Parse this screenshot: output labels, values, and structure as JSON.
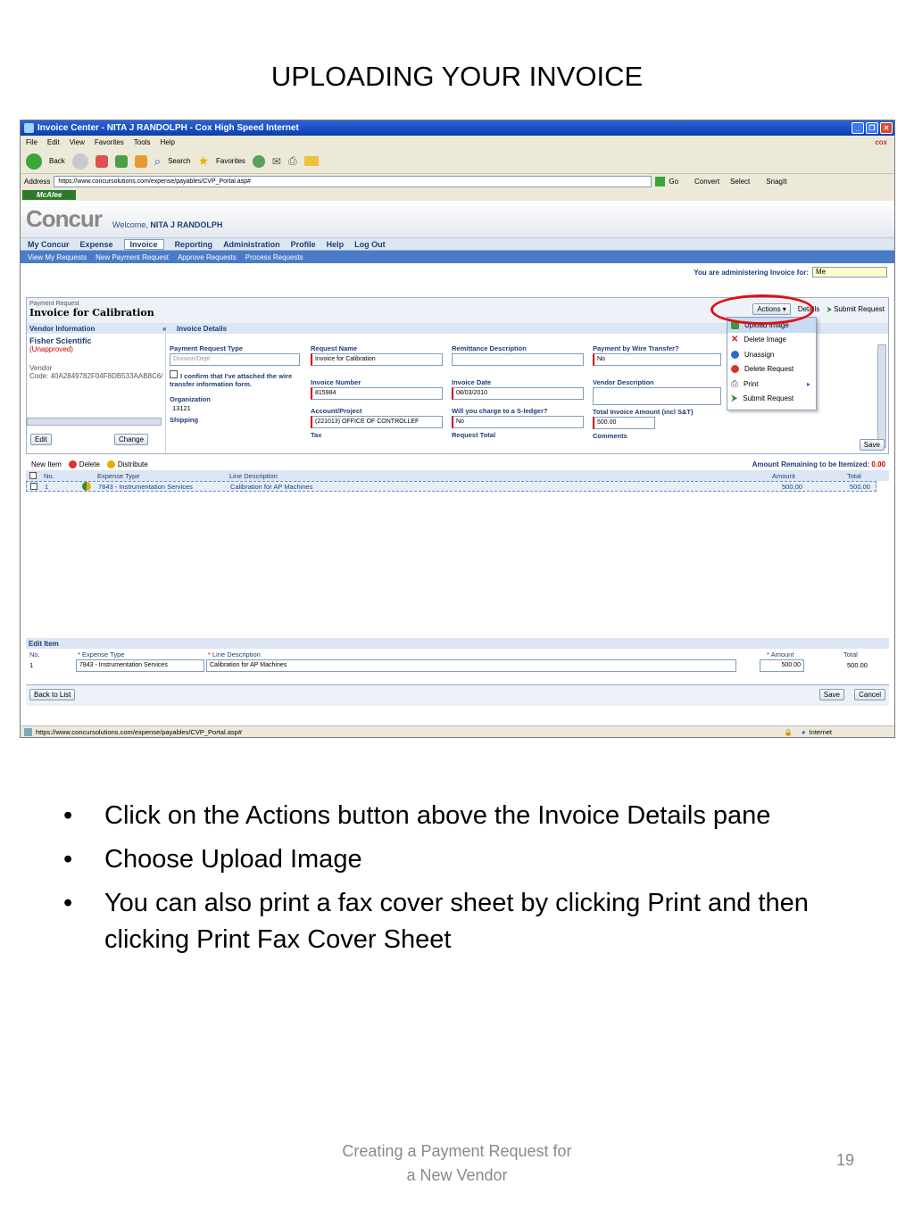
{
  "slide": {
    "title": "UPLOADING YOUR INVOICE",
    "bullets": [
      "Click on the Actions button above the Invoice Details pane",
      "Choose Upload Image",
      "You can also print a fax cover sheet by clicking Print and then clicking Print Fax Cover Sheet"
    ],
    "footer_line1": "Creating a Payment Request for",
    "footer_line2": "a New Vendor",
    "page_number": "19"
  },
  "browser": {
    "window_title": "Invoice Center - NITA J RANDOLPH - Cox High Speed Internet",
    "menu": [
      "File",
      "Edit",
      "View",
      "Favorites",
      "Tools",
      "Help"
    ],
    "brand": "cox",
    "toolbar": {
      "back": "Back",
      "search": "Search",
      "favorites": "Favorites"
    },
    "address_label": "Address",
    "url": "https://www.concursolutions.com/expense/payables/CVP_Portal.asp#",
    "go": "Go",
    "convert": "Convert",
    "select": "Select",
    "snagit": "SnagIt",
    "mcafee": "McAfee",
    "status_url": "https://www.concursolutions.com/expense/payables/CVP_Portal.asp#",
    "status_zone": "Internet"
  },
  "app": {
    "logo": "Concur",
    "welcome_prefix": "Welcome,",
    "user": "NITA J RANDOLPH",
    "nav": [
      "My Concur",
      "Expense",
      "Invoice",
      "Reporting",
      "Administration",
      "Profile",
      "Help",
      "Log Out"
    ],
    "subnav": [
      "View My Requests",
      "New Payment Request",
      "Approve Requests",
      "Process Requests"
    ],
    "admin_label": "You are administering Invoice for:",
    "admin_value": "Me",
    "request": {
      "kind": "Payment Request",
      "title": "Invoice for Calibration",
      "actions_label": "Actions",
      "details_label": "Details",
      "submit_label": "Submit Request"
    },
    "vendor": {
      "section": "Vendor Information",
      "name": "Fisher Scientific",
      "status": "(Unapproved)",
      "vendor_label": "Vendor",
      "code": "Code: 40A2849782F04F8DB533AAB8C6/"
    },
    "details": {
      "section": "Invoice Details",
      "payment_request_type_label": "Payment Request Type",
      "payment_request_type_value": "Division/Dept",
      "confirm_text": "I confirm that I've attached the wire transfer information form.",
      "request_name_label": "Request Name",
      "request_name_value": "Invoice for Calibration",
      "remittance_label": "Remittance Description",
      "wire_label": "Payment by Wire Transfer?",
      "wire_value": "No",
      "invoice_number_label": "Invoice Number",
      "invoice_number_value": "815984",
      "invoice_date_label": "Invoice Date",
      "invoice_date_value": "08/03/2010",
      "vendor_desc_label": "Vendor Description",
      "organization_label": "Organization",
      "organization_value": "13121",
      "account_label": "Account/Project",
      "account_value": "(221013) OFFICE OF CONTROLLEF",
      "sledger_label": "Will you charge to a S-ledger?",
      "sledger_value": "No",
      "total_label": "Total Invoice Amount (incl S&T)",
      "total_value": "500.00",
      "shipping_label": "Shipping",
      "tax_label": "Tax",
      "request_total_label": "Request Total",
      "comments_label": "Comments",
      "edit_btn": "Edit",
      "change_btn": "Change",
      "save_btn": "Save"
    },
    "actions_menu": [
      "Upload Image",
      "Delete Image",
      "Unassign",
      "Delete Request",
      "Print",
      "Submit Request"
    ],
    "items": {
      "new_item": "New Item",
      "delete": "Delete",
      "distribute": "Distribute",
      "remaining_label": "Amount Remaining to be Itemized:",
      "remaining_value": "0.00",
      "columns": [
        "No.",
        "Expense Type",
        "Line Description",
        "Amount",
        "Total"
      ],
      "rows": [
        {
          "no": "1",
          "type": "7843 - Instrumentation Services",
          "desc": "Calibration for AP Machines",
          "amount": "500.00",
          "total": "500.00"
        }
      ]
    },
    "edit_item": {
      "section": "Edit Item",
      "columns": [
        "No.",
        "Expense Type",
        "Line Description",
        "Amount",
        "Total"
      ],
      "no": "1",
      "type": "7843 - Instrumentation Services",
      "desc": "Calibration for AP Machines",
      "amount": "500.00",
      "total": "500.00",
      "back_btn": "Back to List",
      "save_btn": "Save",
      "cancel_btn": "Cancel"
    }
  }
}
